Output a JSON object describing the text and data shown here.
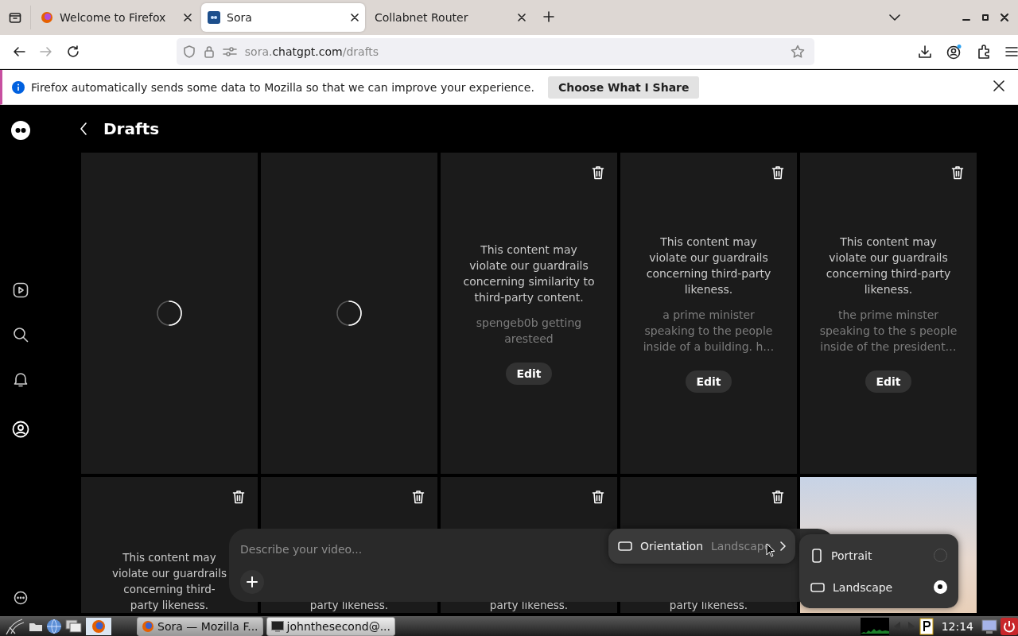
{
  "browser": {
    "tabs": [
      {
        "title": "Welcome to Firefox",
        "selected": false,
        "kind": "firefox"
      },
      {
        "title": "Sora",
        "selected": true,
        "kind": "sora"
      },
      {
        "title": "Collabnet Router",
        "selected": false,
        "kind": "plain"
      }
    ],
    "url": {
      "subdomain": "sora.",
      "domain": "chatgpt.com",
      "path": "/drafts"
    },
    "notification": {
      "message": "Firefox automatically sends some data to Mozilla so that we can improve your experience.",
      "button": "Choose What I Share"
    }
  },
  "page": {
    "title": "Drafts",
    "drafts": [
      {
        "kind": "loading"
      },
      {
        "kind": "loading"
      },
      {
        "kind": "blocked",
        "message": "This content may violate our guardrails concerning similarity to third-party content.",
        "prompt": "spengeb0b getting aresteed",
        "action": "Edit"
      },
      {
        "kind": "blocked",
        "message": "This content may violate our guardrails concerning third-party likeness.",
        "prompt": "a prime minister speaking to the people inside of a building. h…",
        "action": "Edit"
      },
      {
        "kind": "blocked",
        "message": "This content may violate our guardrails concerning third-party likeness.",
        "prompt": "the prime minster speaking to the s people inside of the president…",
        "action": "Edit"
      },
      {
        "kind": "blocked",
        "message": "This content may violate our guardrails concerning third-party likeness."
      },
      {
        "kind": "blocked",
        "message": "party likeness."
      },
      {
        "kind": "blocked",
        "message": "party likeness."
      },
      {
        "kind": "blocked",
        "message": "party likeness."
      },
      {
        "kind": "video"
      }
    ]
  },
  "composer": {
    "placeholder": "Describe your video...",
    "orientation": {
      "label": "Orientation",
      "value": "Landscape"
    },
    "orientation_options": [
      {
        "label": "Portrait",
        "kind": "portrait",
        "selected": false
      },
      {
        "label": "Landscape",
        "kind": "landscape",
        "selected": true
      }
    ]
  },
  "taskbar": {
    "windows": [
      {
        "title": "Sora — Mozilla F...",
        "selected": true,
        "kind": "browser"
      },
      {
        "title": "johnthesecond@...",
        "selected": false,
        "kind": "terminal"
      }
    ],
    "clock": "12:14"
  }
}
